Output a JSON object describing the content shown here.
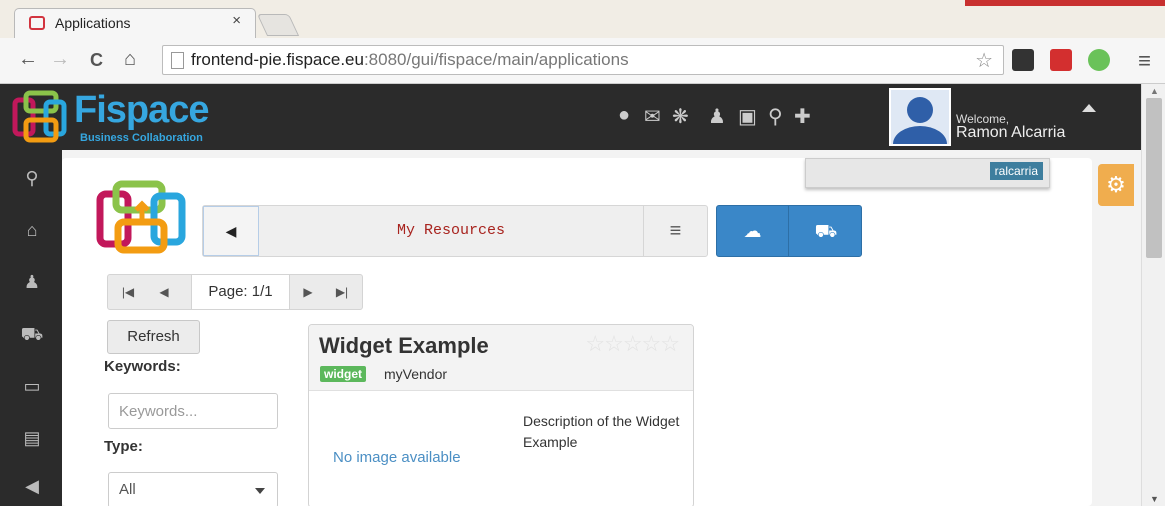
{
  "browser": {
    "tab_title": "Applications",
    "tab_close": "×",
    "url_prefix": "frontend-pie.fispace.eu",
    "url_rest": ":8080/gui/fispace/main/applications",
    "back": "←",
    "forward": "→",
    "reload": "C",
    "home": "⌂",
    "bookmark_star": "☆",
    "menu": "≡"
  },
  "header": {
    "logo_text": "Fispace",
    "logo_subtitle": "Business Collaboration",
    "icons": [
      "globe-icon",
      "mail-icon",
      "chat-icon",
      "users-icon",
      "briefcase-icon",
      "search-icon",
      "puzzle-icon"
    ],
    "welcome_label": "Welcome,",
    "user_name": "Ramon Alcarria",
    "username_tag": "ralcarria"
  },
  "leftnav": {
    "items": [
      "search-icon",
      "home-icon",
      "user-icon",
      "cart-icon",
      "inbox-icon",
      "list-icon",
      "megaphone-icon"
    ]
  },
  "resources": {
    "title": "My Resources"
  },
  "pager": {
    "label": "Page: 1/1"
  },
  "filters": {
    "refresh_label": "Refresh",
    "keywords_label": "Keywords:",
    "keywords_placeholder": "Keywords...",
    "type_label": "Type:",
    "type_value": "All"
  },
  "card": {
    "title": "Widget Example",
    "badge": "widget",
    "vendor": "myVendor",
    "rating_stars": "☆☆☆☆☆",
    "no_image": "No image available",
    "description": "Description of the Widget Example"
  },
  "colors": {
    "header_bg": "#2b2b2b",
    "accent_blue": "#3a87c8",
    "badge_green": "#5cb85c",
    "settings_orange": "#f0ad4e",
    "title_red": "#a8231e"
  }
}
